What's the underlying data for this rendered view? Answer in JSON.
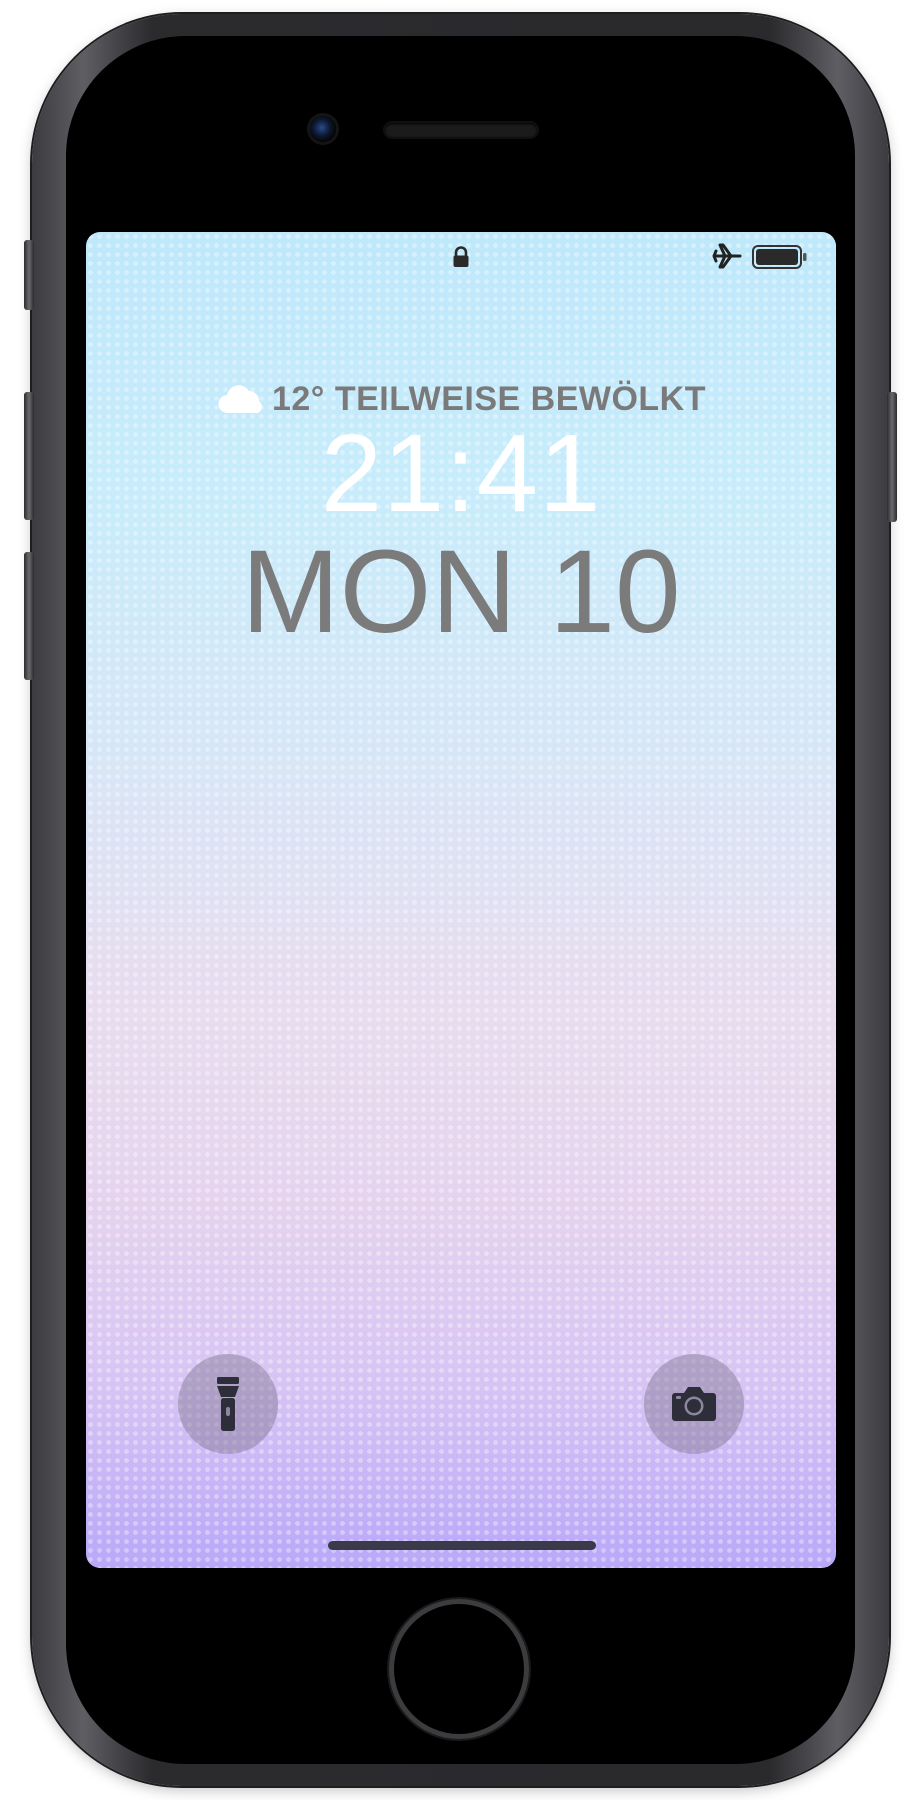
{
  "device": {
    "model": "iPhone"
  },
  "status_bar": {
    "lock_icon": "lock-icon",
    "airplane_icon": "airplane-icon",
    "battery_icon": "battery-icon"
  },
  "lock_screen": {
    "weather": {
      "icon": "cloud-icon",
      "text": "12° TEILWEISE BEWÖLKT"
    },
    "time": "21:41",
    "date": "MON 10"
  },
  "quick_actions": {
    "flashlight_icon": "flashlight-icon",
    "camera_icon": "camera-icon"
  },
  "colors": {
    "clock": "#ffffff",
    "date": "#7b7b7b",
    "weather_text": "#7a7a7a",
    "wallpaper_top": "#bfe8fb",
    "wallpaper_bottom": "#b8a8f8"
  }
}
